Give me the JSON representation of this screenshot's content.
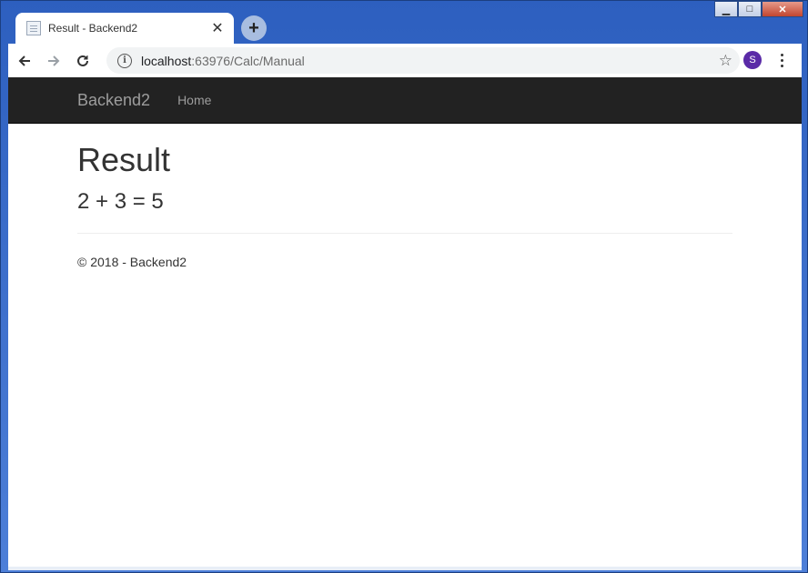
{
  "browser": {
    "tab_title": "Result - Backend2",
    "url_host": "localhost",
    "url_path": ":63976/Calc/Manual",
    "profile_initial": "S"
  },
  "site": {
    "brand": "Backend2",
    "nav": [
      {
        "label": "Home"
      }
    ]
  },
  "page": {
    "title": "Result",
    "result": "2 + 3 = 5",
    "footer": "© 2018 - Backend2"
  }
}
